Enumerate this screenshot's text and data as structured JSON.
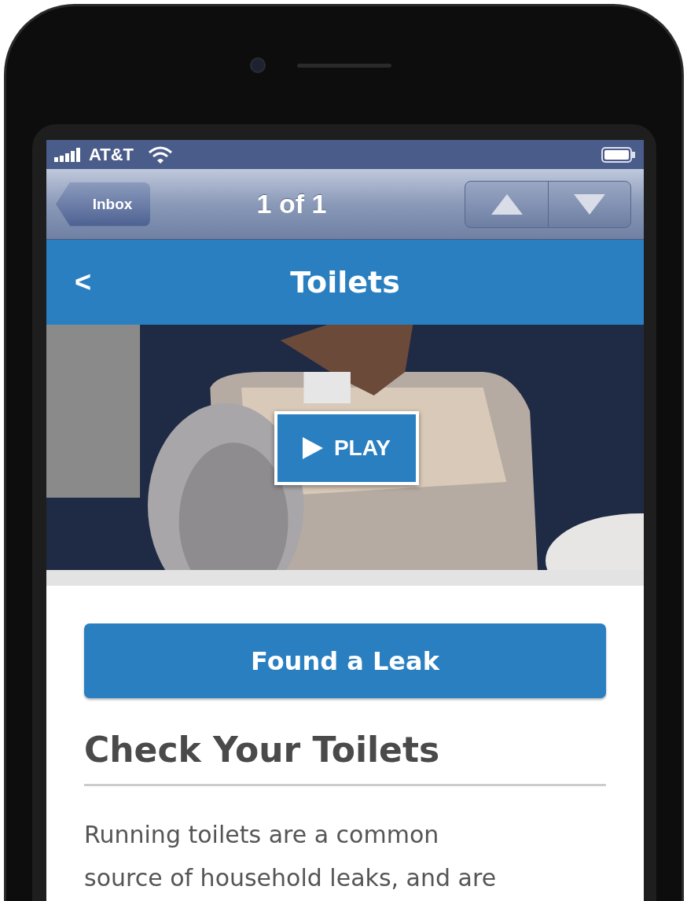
{
  "status_bar": {
    "carrier": "AT&T"
  },
  "mail_nav": {
    "back_label": "Inbox",
    "title": "1 of 1"
  },
  "header": {
    "back": "<",
    "title": "Toilets"
  },
  "video": {
    "kind": "picture",
    "play_label": "PLAY"
  },
  "primary_button": {
    "label": "Found a Leak"
  },
  "section": {
    "heading": "Check Your Toilets",
    "body": "Running toilets are a common\nsource of household leaks, and are"
  }
}
